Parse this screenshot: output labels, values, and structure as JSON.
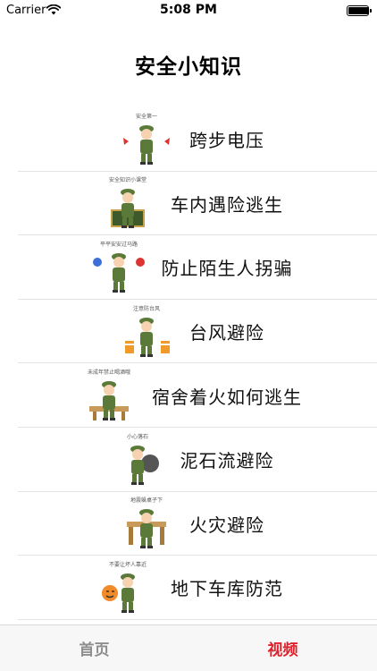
{
  "status_bar": {
    "carrier": "Carrier",
    "time": "5:08 PM",
    "battery_level": 1.0
  },
  "nav": {
    "title": "安全小知识"
  },
  "items": [
    {
      "label": "跨步电压",
      "caption": "安全第一"
    },
    {
      "label": "车内遇险逃生",
      "caption": "安全知识小课堂"
    },
    {
      "label": "防止陌生人拐骗",
      "caption": "平平安安过马路"
    },
    {
      "label": "台风避险",
      "caption": "注意防台风"
    },
    {
      "label": "宿舍着火如何逃生",
      "caption": "未成年禁止喝酒哦"
    },
    {
      "label": "泥石流避险",
      "caption": "小心落石"
    },
    {
      "label": "火灾避险",
      "caption": "地震躲桌子下"
    },
    {
      "label": "地下车库防范",
      "caption": "不要让坏人靠近"
    }
  ],
  "tabs": [
    {
      "label": "首页",
      "active": false
    },
    {
      "label": "视频",
      "active": true
    }
  ],
  "colors": {
    "active_tab": "#e0202a",
    "inactive_tab": "#8e8e8e",
    "soldier_green": "#5b7a3a"
  }
}
